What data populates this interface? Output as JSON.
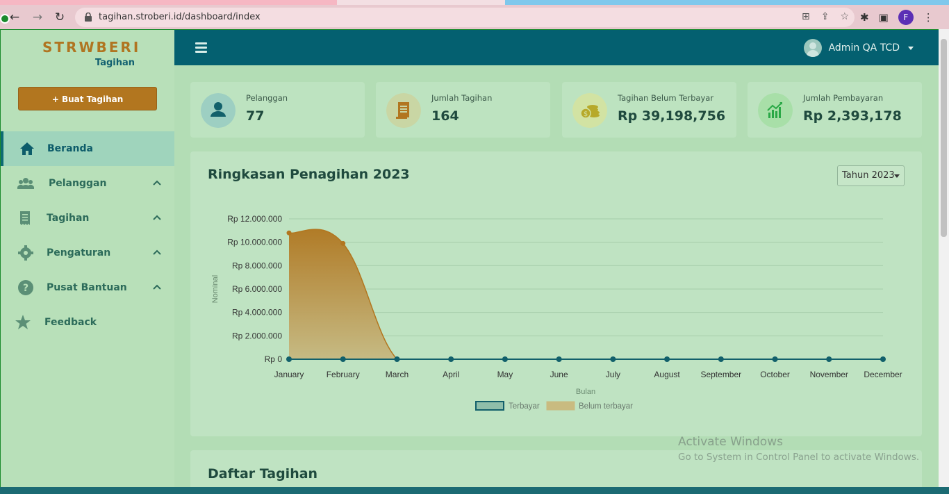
{
  "browser": {
    "url": "tagihan.stroberi.id/dashboard/index",
    "profile_initial": "F"
  },
  "sidebar": {
    "logo_main": "STRWBERI",
    "logo_sub": "Tagihan",
    "create_button": "+ Buat Tagihan",
    "items": [
      {
        "label": "Beranda",
        "icon": "home-icon",
        "active": true
      },
      {
        "label": "Pelanggan",
        "icon": "users-icon",
        "expandable": true
      },
      {
        "label": "Tagihan",
        "icon": "receipt-icon",
        "expandable": true
      },
      {
        "label": "Pengaturan",
        "icon": "gear-icon",
        "expandable": true
      },
      {
        "label": "Pusat Bantuan",
        "icon": "help-icon",
        "expandable": true
      },
      {
        "label": "Feedback",
        "icon": "star-icon"
      }
    ]
  },
  "header": {
    "user_name": "Admin QA TCD"
  },
  "stats": [
    {
      "label": "Pelanggan",
      "value": "77",
      "icon": "user-icon",
      "color": "#12606b"
    },
    {
      "label": "Jumlah Tagihan",
      "value": "164",
      "icon": "invoice-icon",
      "color": "#b2761f"
    },
    {
      "label": "Tagihan Belum Terbayar",
      "value": "Rp 39,198,756",
      "icon": "coins-icon",
      "color": "#b7a92a"
    },
    {
      "label": "Jumlah Pembayaran",
      "value": "Rp 2,393,178",
      "icon": "chart-up-icon",
      "color": "#2aa846"
    }
  ],
  "chart_panel": {
    "title": "Ringkasan Penagihan 2023",
    "year_selector": "Tahun 2023"
  },
  "chart_data": {
    "type": "area",
    "x": [
      "January",
      "February",
      "March",
      "April",
      "May",
      "June",
      "July",
      "August",
      "September",
      "October",
      "November",
      "December"
    ],
    "series": [
      {
        "name": "Terbayar",
        "values": [
          0,
          0,
          0,
          0,
          0,
          0,
          0,
          0,
          0,
          0,
          0,
          0
        ],
        "color": "#12606b"
      },
      {
        "name": "Belum terbayar",
        "values": [
          10800000,
          9900000,
          0,
          0,
          0,
          0,
          0,
          0,
          0,
          0,
          0,
          0
        ],
        "color": "#b2761f"
      }
    ],
    "yticks": [
      "Rp 0",
      "Rp 2.000.000",
      "Rp 4.000.000",
      "Rp 6.000.000",
      "Rp 8.000.000",
      "Rp 10.000.000",
      "Rp 12.000.000"
    ],
    "ylim": [
      0,
      12000000
    ],
    "xlabel": "Bulan",
    "ylabel": "Nominal",
    "legend_position": "bottom"
  },
  "list_panel": {
    "title": "Daftar Tagihan"
  },
  "watermark": {
    "line1": "Activate Windows",
    "line2": "Go to System in Control Panel to activate Windows."
  }
}
